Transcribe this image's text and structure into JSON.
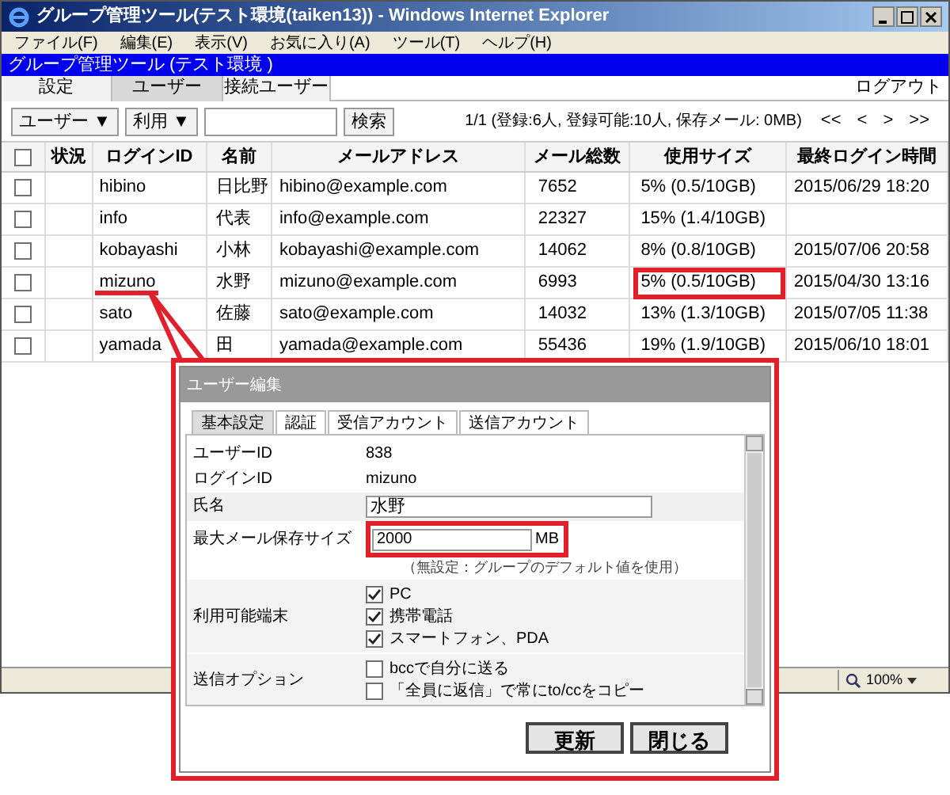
{
  "window": {
    "title": "グループ管理ツール(テスト環境(taiken13)) - Windows Internet Explorer"
  },
  "menu": [
    "ファイル(F)",
    "編集(E)",
    "表示(V)",
    "お気に入り(A)",
    "ツール(T)",
    "ヘルプ(H)"
  ],
  "app_title": "グループ管理ツール (テスト環境 )",
  "nav_tabs": [
    {
      "label": "設定",
      "selected": false
    },
    {
      "label": "ユーザー",
      "selected": true
    },
    {
      "label": "接続ユーザー",
      "selected": false
    }
  ],
  "logout": "ログアウト",
  "toolbar": {
    "dropdowns": [
      "ユーザー ▼",
      "利用 ▼"
    ],
    "search_button": "検索",
    "summary": "1/1 (登録:6人, 登録可能:10人, 保存メール: 0MB)",
    "pager": [
      "<<",
      "<",
      ">",
      ">>"
    ]
  },
  "table": {
    "columns": [
      "状況",
      "ログインID",
      "名前",
      "メールアドレス",
      "メール総数",
      "使用サイズ",
      "最終ログイン時間"
    ],
    "select_all": {
      "checked": false
    },
    "rows": [
      {
        "checked": false,
        "highlighted": false,
        "cells": [
          "",
          "hibino",
          "日比野",
          "hibino@example.com",
          "7652",
          "5% (0.5/10GB)",
          "2015/06/29 18:20"
        ]
      },
      {
        "checked": false,
        "highlighted": false,
        "cells": [
          "",
          "info",
          "代表",
          "info@example.com",
          "22327",
          "15% (1.4/10GB)",
          ""
        ]
      },
      {
        "checked": false,
        "highlighted": false,
        "cells": [
          "",
          "kobayashi",
          "小林",
          "kobayashi@example.com",
          "14062",
          "8% (0.8/10GB)",
          "2015/07/06 20:58"
        ]
      },
      {
        "checked": false,
        "highlighted": true,
        "cells": [
          "",
          "mizuno",
          "水野",
          "mizuno@example.com",
          "6993",
          "5% (0.5/10GB)",
          "2015/04/30 13:16"
        ]
      },
      {
        "checked": false,
        "highlighted": false,
        "cells": [
          "",
          "sato",
          "佐藤",
          "sato@example.com",
          "14032",
          "13% (1.3/10GB)",
          "2015/07/05 11:38"
        ]
      },
      {
        "checked": false,
        "highlighted": false,
        "cells": [
          "",
          "yamada",
          "田",
          "yamada@example.com",
          "55436",
          "19% (1.9/10GB)",
          "2015/06/10 18:01"
        ]
      }
    ]
  },
  "status_bar": {
    "zoom": "100%"
  },
  "dialog": {
    "title": "ユーザー編集",
    "tabs": [
      {
        "label": "基本設定",
        "selected": true
      },
      {
        "label": "認証",
        "selected": false
      },
      {
        "label": "受信アカウント",
        "selected": false
      },
      {
        "label": "送信アカウント",
        "selected": false
      }
    ],
    "fields": [
      {
        "kind": "text",
        "label": "ユーザーID",
        "value": "838"
      },
      {
        "kind": "text",
        "label": "ログインID",
        "value": "mizuno"
      },
      {
        "kind": "input",
        "label": "氏名",
        "value": "水野"
      },
      {
        "kind": "size",
        "label": "最大メール保存サイズ",
        "value": "2000",
        "unit": "MB",
        "highlighted": true,
        "hint": "（無設定：グループのデフォルト値を使用）"
      },
      {
        "kind": "checks",
        "label": "利用可能端末",
        "options": [
          {
            "label": "PC",
            "checked": true
          },
          {
            "label": "携帯電話",
            "checked": true
          },
          {
            "label": "スマートフォン、PDA",
            "checked": true
          }
        ]
      },
      {
        "kind": "checks",
        "label": "送信オプション",
        "options": [
          {
            "label": "bccで自分に送る",
            "checked": false
          },
          {
            "label": "「全員に返信」で常にto/ccをコピー",
            "checked": false
          }
        ]
      }
    ],
    "buttons": [
      "更新",
      "閉じる"
    ]
  }
}
